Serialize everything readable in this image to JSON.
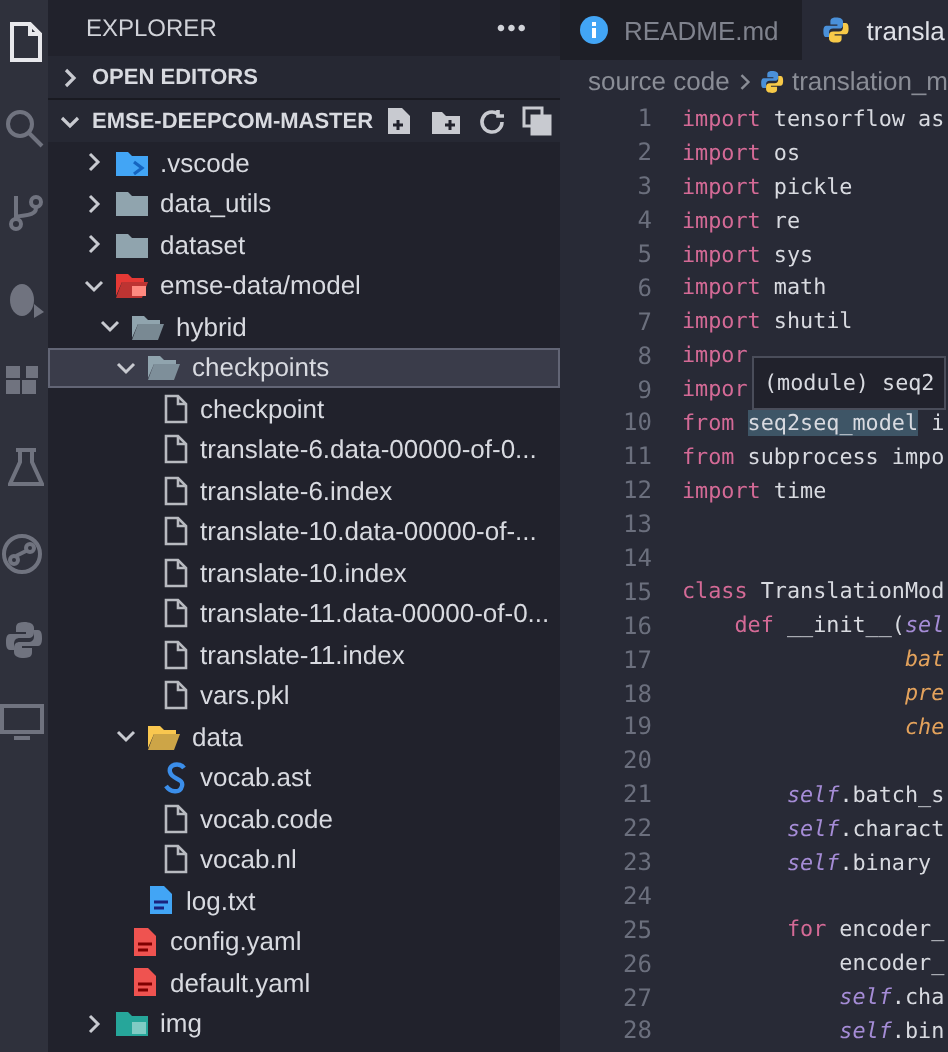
{
  "activity_bar": {
    "items": [
      {
        "kind": "files",
        "selected": true
      },
      {
        "kind": "search",
        "selected": false
      },
      {
        "kind": "source-control",
        "selected": false
      },
      {
        "kind": "debug",
        "selected": false
      },
      {
        "kind": "extensions",
        "selected": false
      },
      {
        "kind": "flask",
        "selected": false
      },
      {
        "kind": "graph",
        "selected": false
      },
      {
        "kind": "python",
        "selected": false
      },
      {
        "kind": "monitor",
        "selected": false
      }
    ]
  },
  "sidebar": {
    "title": "EXPLORER",
    "more": "•••",
    "sections": [
      {
        "label": "OPEN EDITORS",
        "expanded": false
      },
      {
        "label": "EMSE-DEEPCOM-MASTER",
        "expanded": true
      }
    ],
    "tree": [
      {
        "label": ".vscode",
        "kind": "vscode-folder",
        "expanded": false,
        "selected": false
      },
      {
        "label": "data_utils",
        "kind": "folder",
        "expanded": false,
        "selected": false
      },
      {
        "label": "dataset",
        "kind": "folder",
        "expanded": false,
        "selected": false
      },
      {
        "label": "emse-data/model",
        "kind": "red-folder",
        "expanded": true,
        "selected": false,
        "children": [
          {
            "label": "hybrid",
            "kind": "folder",
            "expanded": true,
            "selected": false,
            "children": [
              {
                "label": "checkpoints",
                "kind": "folder",
                "expanded": true,
                "selected": true,
                "children": [
                  {
                    "label": "checkpoint",
                    "kind": "file",
                    "selected": false
                  },
                  {
                    "label": "translate-6.data-00000-of-0...",
                    "kind": "file",
                    "selected": false
                  },
                  {
                    "label": "translate-6.index",
                    "kind": "file",
                    "selected": false
                  },
                  {
                    "label": "translate-10.data-00000-of-...",
                    "kind": "file",
                    "selected": false
                  },
                  {
                    "label": "translate-10.index",
                    "kind": "file",
                    "selected": false
                  },
                  {
                    "label": "translate-11.data-00000-of-0...",
                    "kind": "file",
                    "selected": false
                  },
                  {
                    "label": "translate-11.index",
                    "kind": "file",
                    "selected": false
                  },
                  {
                    "label": "vars.pkl",
                    "kind": "file",
                    "selected": false
                  }
                ]
              },
              {
                "label": "data",
                "kind": "yellow-folder",
                "expanded": true,
                "selected": false,
                "children": [
                  {
                    "label": "vocab.ast",
                    "kind": "s-file",
                    "selected": false
                  },
                  {
                    "label": "vocab.code",
                    "kind": "file",
                    "selected": false
                  },
                  {
                    "label": "vocab.nl",
                    "kind": "file",
                    "selected": false
                  }
                ]
              },
              {
                "label": "log.txt",
                "kind": "text-file",
                "selected": false
              }
            ]
          },
          {
            "label": "config.yaml",
            "kind": "yaml-file",
            "selected": false
          },
          {
            "label": "default.yaml",
            "kind": "yaml-file",
            "selected": false
          }
        ]
      },
      {
        "label": "img",
        "kind": "green-folder",
        "expanded": false,
        "selected": false
      }
    ]
  },
  "tabs": [
    {
      "label": "README.md",
      "kind": "info",
      "selected": false
    },
    {
      "label": "transla",
      "kind": "python",
      "selected": true
    }
  ],
  "breadcrumb": [
    {
      "label": "source code",
      "kind": "text"
    },
    {
      "label": "translation_m",
      "kind": "python"
    }
  ],
  "editor": {
    "lines": [
      {
        "number": "1",
        "tokens": [
          {
            "kind": "keyword",
            "text": "import"
          },
          {
            "kind": "plain",
            "text": " tensorflow as"
          }
        ]
      },
      {
        "number": "2",
        "tokens": [
          {
            "kind": "keyword",
            "text": "import"
          },
          {
            "kind": "plain",
            "text": " os"
          }
        ]
      },
      {
        "number": "3",
        "tokens": [
          {
            "kind": "keyword",
            "text": "import"
          },
          {
            "kind": "plain",
            "text": " pickle"
          }
        ]
      },
      {
        "number": "4",
        "tokens": [
          {
            "kind": "keyword",
            "text": "import"
          },
          {
            "kind": "plain",
            "text": " re"
          }
        ]
      },
      {
        "number": "5",
        "tokens": [
          {
            "kind": "keyword",
            "text": "import"
          },
          {
            "kind": "plain",
            "text": " sys"
          }
        ]
      },
      {
        "number": "6",
        "tokens": [
          {
            "kind": "keyword",
            "text": "import"
          },
          {
            "kind": "plain",
            "text": " math"
          }
        ]
      },
      {
        "number": "7",
        "tokens": [
          {
            "kind": "keyword",
            "text": "import"
          },
          {
            "kind": "plain",
            "text": " shutil"
          }
        ]
      },
      {
        "number": "8",
        "tokens": [
          {
            "kind": "keyword",
            "text": "impor"
          }
        ]
      },
      {
        "number": "9",
        "tokens": [
          {
            "kind": "keyword",
            "text": "impor"
          }
        ]
      },
      {
        "number": "10",
        "tokens": [
          {
            "kind": "keyword",
            "text": "from "
          },
          {
            "kind": "highlight",
            "text": "seq2seq_model"
          },
          {
            "kind": "plain",
            "text": " i"
          }
        ]
      },
      {
        "number": "11",
        "tokens": [
          {
            "kind": "keyword",
            "text": "from"
          },
          {
            "kind": "plain",
            "text": " subprocess impo"
          }
        ]
      },
      {
        "number": "12",
        "tokens": [
          {
            "kind": "keyword",
            "text": "import"
          },
          {
            "kind": "plain",
            "text": " time"
          }
        ]
      },
      {
        "number": "13"
      },
      {
        "number": "14"
      },
      {
        "number": "15",
        "tokens": [
          {
            "kind": "keyword",
            "text": "class"
          },
          {
            "kind": "plain",
            "text": " TranslationMod"
          }
        ]
      },
      {
        "number": "16",
        "tokens": [
          {
            "kind": "keyword",
            "text": "    def"
          },
          {
            "kind": "plain",
            "text": " __init__("
          },
          {
            "kind": "self",
            "text": "sel"
          }
        ]
      },
      {
        "number": "17",
        "tokens": [
          {
            "kind": "param",
            "text": "                 bat"
          }
        ]
      },
      {
        "number": "18",
        "tokens": [
          {
            "kind": "param",
            "text": "                 pre"
          }
        ]
      },
      {
        "number": "19",
        "tokens": [
          {
            "kind": "param",
            "text": "                 che"
          }
        ]
      },
      {
        "number": "20"
      },
      {
        "number": "21",
        "tokens": [
          {
            "kind": "self",
            "text": "        self"
          },
          {
            "kind": "plain",
            "text": ".batch_s"
          }
        ]
      },
      {
        "number": "22",
        "tokens": [
          {
            "kind": "self",
            "text": "        self"
          },
          {
            "kind": "plain",
            "text": ".charact"
          }
        ]
      },
      {
        "number": "23",
        "tokens": [
          {
            "kind": "self",
            "text": "        self"
          },
          {
            "kind": "plain",
            "text": ".binary"
          }
        ]
      },
      {
        "number": "24"
      },
      {
        "number": "25",
        "tokens": [
          {
            "kind": "keyword",
            "text": "        for"
          },
          {
            "kind": "plain",
            "text": " encoder_"
          }
        ]
      },
      {
        "number": "26",
        "tokens": [
          {
            "kind": "plain",
            "text": "            encoder_"
          }
        ]
      },
      {
        "number": "27",
        "tokens": [
          {
            "kind": "self",
            "text": "            self"
          },
          {
            "kind": "plain",
            "text": ".cha"
          }
        ]
      },
      {
        "number": "28",
        "tokens": [
          {
            "kind": "self",
            "text": "            self"
          },
          {
            "kind": "plain",
            "text": ".bin"
          }
        ]
      }
    ],
    "tooltip": "(module) seq2"
  }
}
